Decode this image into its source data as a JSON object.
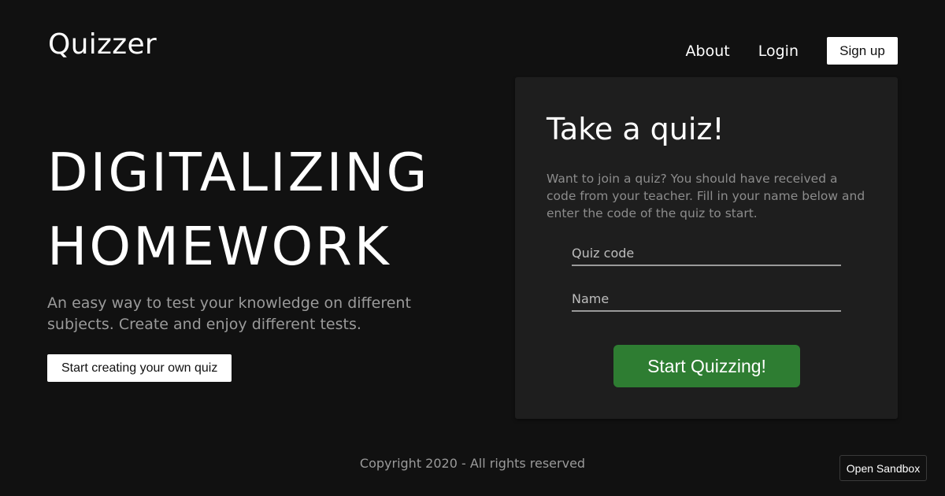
{
  "header": {
    "logo": "Quizzer",
    "nav": {
      "about": "About",
      "login": "Login",
      "signup": "Sign up"
    }
  },
  "hero": {
    "title_line1": "DIGITALIZING",
    "title_line2": "HOMEWORK",
    "subtitle": "An easy way to test your knowledge on different subjects. Create and enjoy different tests.",
    "create_button": "Start creating your own quiz"
  },
  "quiz_card": {
    "title": "Take a quiz!",
    "description": "Want to join a quiz? You should have received a code from your teacher. Fill in your name below and enter the code of the quiz to start.",
    "code_field": {
      "placeholder": "Quiz code",
      "value": ""
    },
    "name_field": {
      "placeholder": "Name",
      "value": ""
    },
    "start_button": "Start Quizzing!"
  },
  "footer": {
    "copyright": "Copyright 2020 - All rights reserved"
  },
  "sandbox_button": "Open Sandbox",
  "colors": {
    "background": "#111111",
    "card": "#1e1e1e",
    "accent_green": "#2e7d32",
    "muted_text": "#9a9a9a"
  }
}
